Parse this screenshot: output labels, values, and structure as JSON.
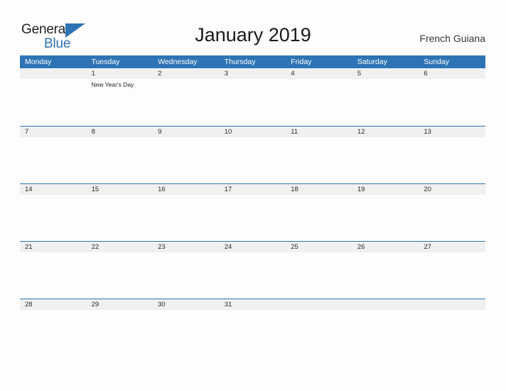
{
  "brand": {
    "name_part1": "General",
    "name_part2": "Blue",
    "triangle_color": "#2E74B5",
    "text_color": "#231F20"
  },
  "header": {
    "title": "January 2019",
    "locale": "French Guiana"
  },
  "theme": {
    "header_blue": "#2E74B5",
    "date_band_gray": "#F0F0F0",
    "page_background": "#FDFDFD",
    "weekday_text": "#FFFFFF"
  },
  "calendar": {
    "weekdays": [
      "Monday",
      "Tuesday",
      "Wednesday",
      "Thursday",
      "Friday",
      "Saturday",
      "Sunday"
    ],
    "weeks": [
      {
        "days": [
          {
            "date": "",
            "event": ""
          },
          {
            "date": "1",
            "event": "New Year's Day"
          },
          {
            "date": "2",
            "event": ""
          },
          {
            "date": "3",
            "event": ""
          },
          {
            "date": "4",
            "event": ""
          },
          {
            "date": "5",
            "event": ""
          },
          {
            "date": "6",
            "event": ""
          }
        ]
      },
      {
        "days": [
          {
            "date": "7",
            "event": ""
          },
          {
            "date": "8",
            "event": ""
          },
          {
            "date": "9",
            "event": ""
          },
          {
            "date": "10",
            "event": ""
          },
          {
            "date": "11",
            "event": ""
          },
          {
            "date": "12",
            "event": ""
          },
          {
            "date": "13",
            "event": ""
          }
        ]
      },
      {
        "days": [
          {
            "date": "14",
            "event": ""
          },
          {
            "date": "15",
            "event": ""
          },
          {
            "date": "16",
            "event": ""
          },
          {
            "date": "17",
            "event": ""
          },
          {
            "date": "18",
            "event": ""
          },
          {
            "date": "19",
            "event": ""
          },
          {
            "date": "20",
            "event": ""
          }
        ]
      },
      {
        "days": [
          {
            "date": "21",
            "event": ""
          },
          {
            "date": "22",
            "event": ""
          },
          {
            "date": "23",
            "event": ""
          },
          {
            "date": "24",
            "event": ""
          },
          {
            "date": "25",
            "event": ""
          },
          {
            "date": "26",
            "event": ""
          },
          {
            "date": "27",
            "event": ""
          }
        ]
      },
      {
        "days": [
          {
            "date": "28",
            "event": ""
          },
          {
            "date": "29",
            "event": ""
          },
          {
            "date": "30",
            "event": ""
          },
          {
            "date": "31",
            "event": ""
          },
          {
            "date": "",
            "event": ""
          },
          {
            "date": "",
            "event": ""
          },
          {
            "date": "",
            "event": ""
          }
        ]
      }
    ]
  }
}
